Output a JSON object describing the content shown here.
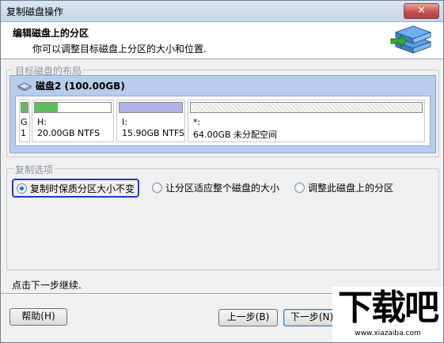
{
  "window": {
    "title": "复制磁盘操作",
    "close_label": "✕"
  },
  "header": {
    "title": "编辑磁盘上的分区",
    "subtitle": "你可以调整目标磁盘上分区的大小和位置."
  },
  "layout_group": {
    "label": "目标磁盘的布局",
    "disk_name": "磁盘2 (100.00GB)",
    "partitions": [
      {
        "name": "G",
        "info": "1",
        "fill_color": "#66b866",
        "used_fraction": 1.0
      },
      {
        "name": "H:",
        "info": "20.00GB NTFS",
        "fill_color": "#5cbf5c",
        "used_fraction": 0.3
      },
      {
        "name": "I:",
        "info": "15.90GB NTFS",
        "fill_color": "#b2b4e6",
        "used_fraction": 1.0
      },
      {
        "name": "*:",
        "info": "64.00GB 未分配空间",
        "fill_color": "#dcdcdc",
        "used_fraction": 0
      }
    ]
  },
  "copy_options": {
    "label": "复制选项",
    "options": [
      {
        "label": "复制时保质分区大小不变",
        "checked": true
      },
      {
        "label": "让分区适应整个磁盘的大小",
        "checked": false
      },
      {
        "label": "调整此磁盘上的分区",
        "checked": false
      }
    ]
  },
  "status_text": "点击下一步继续.",
  "buttons": {
    "help": "帮助(H)",
    "back": "上一步(B)",
    "next": "下一步(N)"
  },
  "watermark": {
    "text": "下载吧",
    "url": "www.xiazaiba.com"
  }
}
